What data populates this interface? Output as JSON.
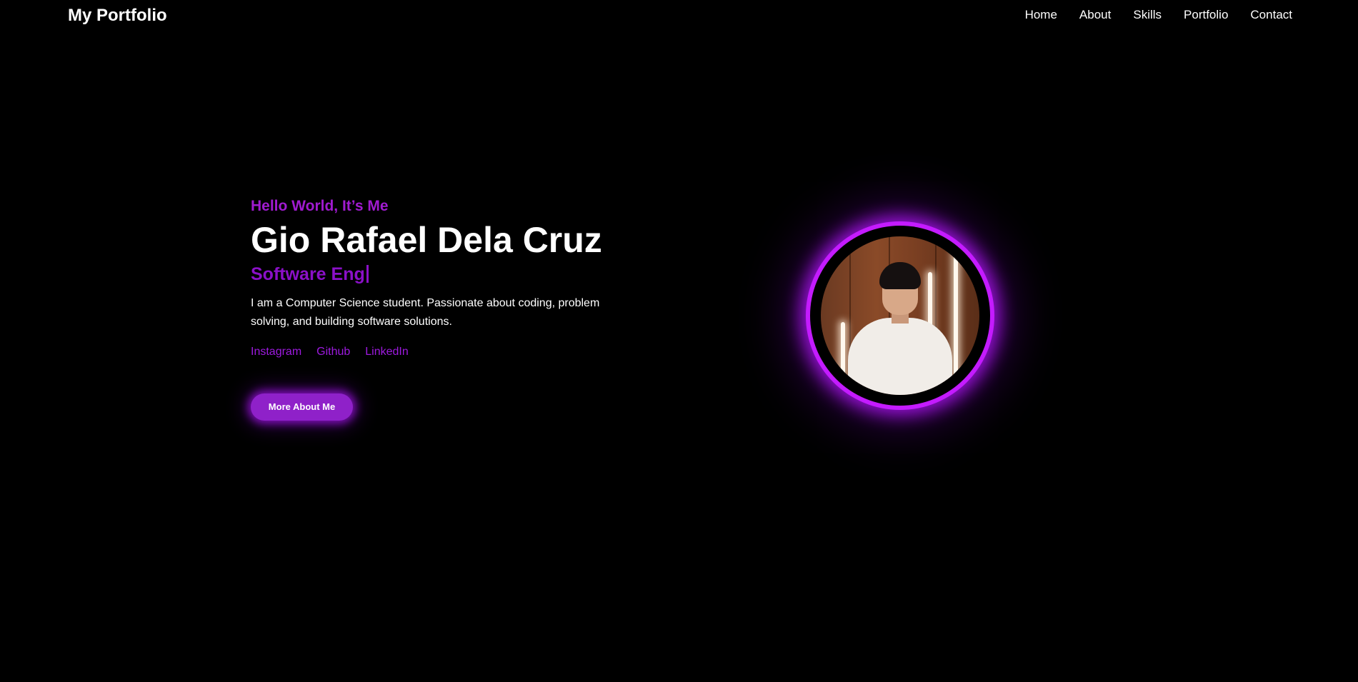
{
  "header": {
    "logo": "My Portfolio",
    "nav": [
      "Home",
      "About",
      "Skills",
      "Portfolio",
      "Contact"
    ]
  },
  "hero": {
    "greeting": "Hello World, It’s Me",
    "name": "Gio Rafael Dela Cruz",
    "role_typed": "Software Eng",
    "bio": "I am a Computer Science student. Passionate about coding, problem solving, and building software solutions.",
    "socials": [
      "Instagram",
      "Github",
      "LinkedIn"
    ],
    "cta_label": "More About Me"
  },
  "colors": {
    "background": "#000000",
    "accent": "#a01bd0",
    "accent_dark": "#8b10c8",
    "button": "#8f21c9",
    "glow": "#c41bff",
    "text": "#ffffff"
  }
}
